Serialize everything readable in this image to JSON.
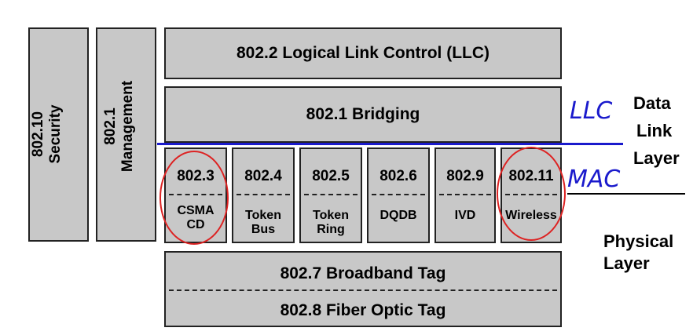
{
  "stack": {
    "security": {
      "number": "802.10",
      "label": "Security"
    },
    "management": {
      "number": "802.1",
      "label": "Management"
    },
    "llc": "802.2 Logical Link Control (LLC)",
    "bridging": "802.1 Bridging",
    "mac_standards": [
      {
        "number": "802.3",
        "label_line1": "CSMA",
        "label_line2": "CD"
      },
      {
        "number": "802.4",
        "label_line1": "Token",
        "label_line2": "Bus"
      },
      {
        "number": "802.5",
        "label_line1": "Token",
        "label_line2": "Ring"
      },
      {
        "number": "802.6",
        "label_line1": "DQDB",
        "label_line2": ""
      },
      {
        "number": "802.9",
        "label_line1": "IVD",
        "label_line2": ""
      },
      {
        "number": "802.11",
        "label_line1": "Wireless",
        "label_line2": ""
      }
    ],
    "broadband": "802.7 Broadband Tag",
    "fiber": "802.8 Fiber Optic Tag"
  },
  "annotations": {
    "llc_handwritten": "LLC",
    "mac_handwritten": "MAC",
    "data_link_line1": "Data",
    "data_link_line2": "Link",
    "data_link_line3": "Layer",
    "physical_line1": "Physical",
    "physical_line2": "Layer"
  },
  "colors": {
    "box_fill": "#c8c8c8",
    "ink_blue": "#1a1acc",
    "circle_red": "#dd2222"
  }
}
